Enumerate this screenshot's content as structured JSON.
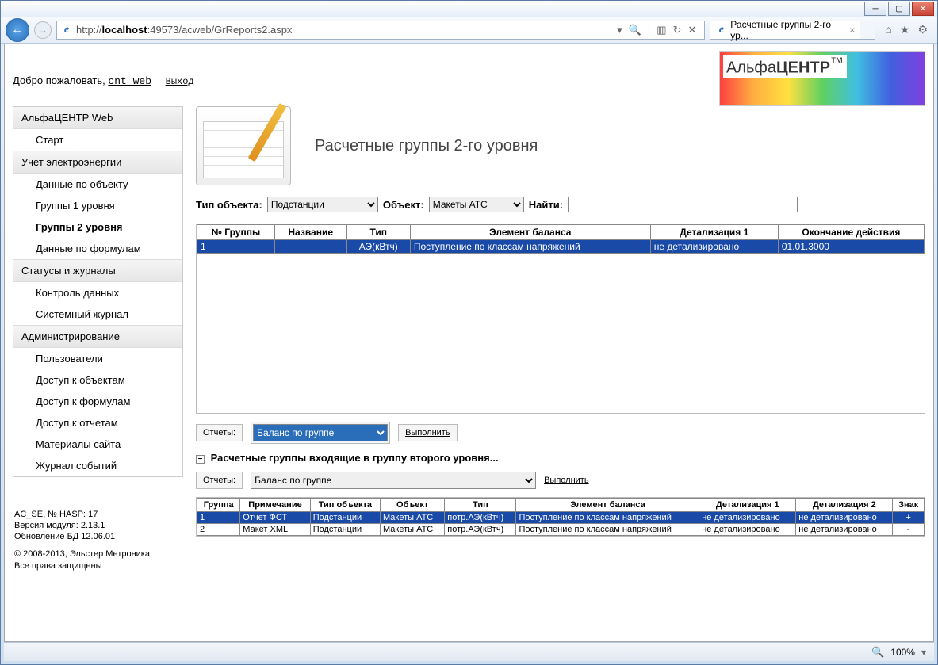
{
  "browser": {
    "url_prefix": "http://",
    "url_host": "localhost",
    "url_port_path": ":49573/acweb/GrReports2.aspx",
    "tab_title": "Расчетные группы 2-го ур...",
    "zoom": "100%"
  },
  "welcome": {
    "text": "Добро пожаловать,",
    "user": "cnt_web",
    "logout": "Выход"
  },
  "logo": {
    "brand1": "Альфа",
    "brand2": "ЦЕНТР"
  },
  "menu": {
    "h1": "АльфаЦЕНТР Web",
    "i1": "Старт",
    "h2": "Учет электроэнергии",
    "i2": "Данные по объекту",
    "i3": "Группы 1 уровня",
    "i4": "Группы 2 уровня",
    "i5": "Данные по формулам",
    "h3": "Статусы и журналы",
    "i6": "Контроль данных",
    "i7": "Системный журнал",
    "h4": "Администрирование",
    "i8": "Пользователи",
    "i9": "Доступ к объектам",
    "i10": "Доступ к формулам",
    "i11": "Доступ к отчетам",
    "i12": "Материалы сайта",
    "i13": "Журнал событий"
  },
  "page_title": "Расчетные группы 2-го уровня",
  "filters": {
    "obj_type_label": "Тип объекта:",
    "obj_type_value": "Подстанции",
    "obj_label": "Объект:",
    "obj_value": "Макеты АТС",
    "find_label": "Найти:",
    "find_value": ""
  },
  "grid1": {
    "headers": {
      "c1": "№ Группы",
      "c2": "Название",
      "c3": "Тип",
      "c4": "Элемент баланса",
      "c5": "Детализация 1",
      "c6": "Окончание действия"
    },
    "row1": {
      "c1": "1",
      "c2": "",
      "c3": "АЭ(кВтч)",
      "c4": "Поступление по классам напряжений",
      "c5": "не детализировано",
      "c6": "01.01.3000"
    }
  },
  "reports1": {
    "label": "Отчеты:",
    "select": "Баланс по группе",
    "run": "Выполнить"
  },
  "sub_heading": "Расчетные группы входящие в группу второго уровня...",
  "reports2": {
    "label": "Отчеты:",
    "select": "Баланс по группе",
    "run": "Выполнить"
  },
  "grid2": {
    "headers": {
      "c1": "Группа",
      "c2": "Примечание",
      "c3": "Тип объекта",
      "c4": "Объект",
      "c5": "Тип",
      "c6": "Элемент баланса",
      "c7": "Детализация 1",
      "c8": "Детализация 2",
      "c9": "Знак"
    },
    "row1": {
      "c1": "1",
      "c2": "Отчет ФСТ",
      "c3": "Подстанции",
      "c4": "Макеты АТС",
      "c5": "потр.АЭ(кВтч)",
      "c6": "Поступление по классам напряжений",
      "c7": "не детализировано",
      "c8": "не детализировано",
      "c9": "+"
    },
    "row2": {
      "c1": "2",
      "c2": "Макет XML",
      "c3": "Подстанции",
      "c4": "Макеты АТС",
      "c5": "потр.АЭ(кВтч)",
      "c6": "Поступление по классам напряжений",
      "c7": "не детализировано",
      "c8": "не детализировано",
      "c9": "-"
    }
  },
  "footer": {
    "l1": "AC_SE, № HASP: 17",
    "l2": "Версия модуля: 2.13.1",
    "l3": "Обновление БД 12.06.01",
    "l4": "© 2008-2013, Эльстер Метроника.",
    "l5": "Все права защищены"
  }
}
